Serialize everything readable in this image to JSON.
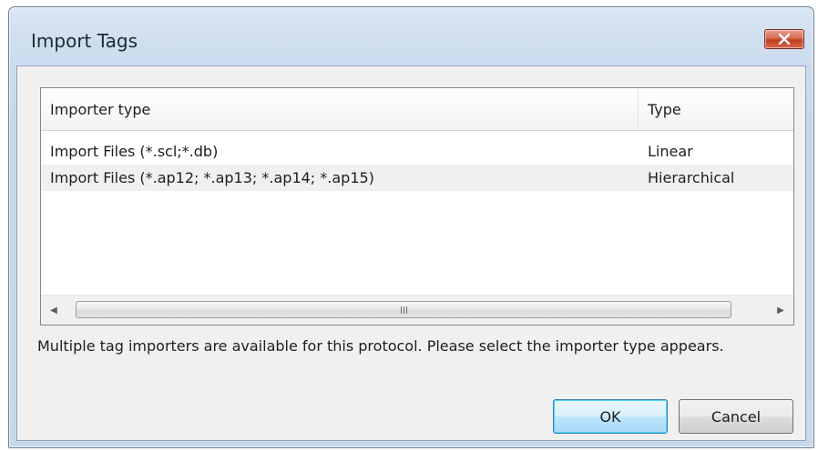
{
  "window": {
    "title": "Import Tags",
    "close_icon": "close-x-icon"
  },
  "list": {
    "columns": [
      "Importer type",
      "Type"
    ],
    "rows": [
      {
        "importer": "Import Files (*.scl;*.db)",
        "type": "Linear"
      },
      {
        "importer": "Import Files (*.ap12; *.ap13; *.ap14; *.ap15)",
        "type": "Hierarchical"
      }
    ],
    "scrollbar": {
      "left_arrow": "◀",
      "right_arrow": "▶",
      "grip_icon": "scroll-grip-icon"
    }
  },
  "message": "Multiple tag importers are available for this protocol. Please select the importer type appears.",
  "buttons": {
    "ok": "OK",
    "cancel": "Cancel"
  },
  "colors": {
    "frame": "#cfdeef",
    "close_button": "#c23f22",
    "default_button_border": "#3c7fb1"
  }
}
